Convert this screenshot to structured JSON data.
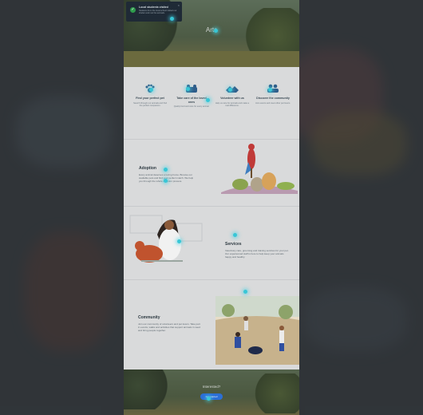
{
  "hero": {
    "title": "Arts"
  },
  "toast": {
    "title": "Local students visited",
    "body": "Students from the local school visited our shelter and met the animals.",
    "close": "×"
  },
  "features": [
    {
      "label": "Find your perfect pet",
      "desc": "Search through our animals and find the perfect companion."
    },
    {
      "label": "Take care of the loved ones",
      "desc": "Quality food and care for every animal."
    },
    {
      "label": "Volunteer with us",
      "desc": "Help us care for animals and make a real difference."
    },
    {
      "label": "Discover the community",
      "desc": "Join events and meet other pet lovers."
    }
  ],
  "adoption": {
    "heading": "Adoption",
    "text": "Every animal deserves a loving home. Browse our available pets and find your perfect match. We help you through the whole adoption process."
  },
  "services": {
    "heading": "Services",
    "text": "Veterinary care, grooming and training services for your pet. Our experienced staff is here to help keep your animals happy and healthy."
  },
  "community": {
    "heading": "Community",
    "text": "Join our community of volunteers and pet lovers. Take part in events, walks and activities that support animals in need and bring people together."
  },
  "cta": {
    "question": "Interested?",
    "button": "Get started"
  },
  "colors": {
    "accent": "#2c6fd6",
    "highlight": "#38c6d6",
    "success": "#2e9b4c"
  }
}
